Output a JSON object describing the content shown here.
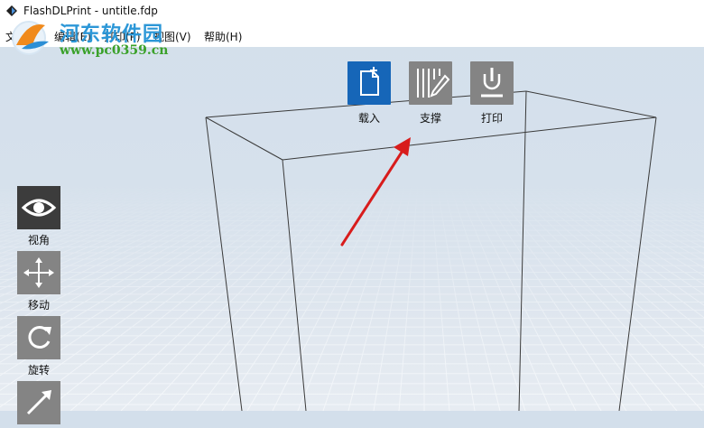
{
  "window": {
    "title": "FlashDLPrint - untitle.fdp"
  },
  "menu": [
    {
      "id": "file",
      "label": "文件(F)"
    },
    {
      "id": "edit",
      "label": "编辑(E)"
    },
    {
      "id": "print",
      "label": "打印(P)"
    },
    {
      "id": "view",
      "label": "视图(V)"
    },
    {
      "id": "help",
      "label": "帮助(H)"
    }
  ],
  "watermark": {
    "title": "河东软件园",
    "url": "www.pc0359.cn"
  },
  "toolbar": {
    "load_label": "载入",
    "support_label": "支撑",
    "print_label": "打印"
  },
  "side_tools": {
    "view_label": "视角",
    "move_label": "移动",
    "rotate_label": "旋转"
  },
  "colors": {
    "active_button": "#1666b8",
    "inactive_button": "#848484",
    "dark_button": "#3c3c3c",
    "arrow": "#d81c1c"
  }
}
